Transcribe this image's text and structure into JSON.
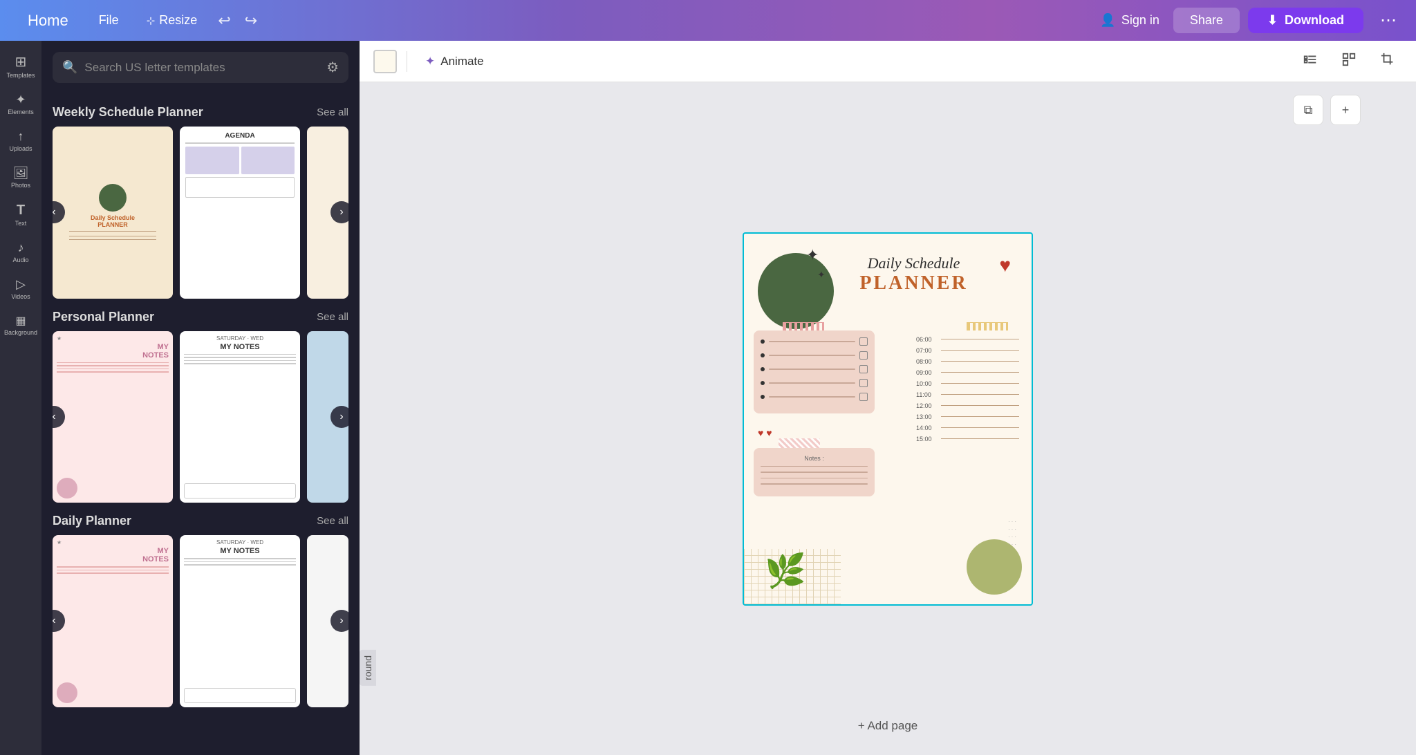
{
  "topNav": {
    "home": "Home",
    "file": "File",
    "resize": "Resize",
    "undo_icon": "↩",
    "redo_icon": "↪",
    "signin": "Sign in",
    "share": "Share",
    "download": "Download",
    "more_icon": "⋯"
  },
  "leftBar": {
    "items": [
      {
        "label": "Templates",
        "icon": "⊞"
      },
      {
        "label": "Elements",
        "icon": "✦"
      },
      {
        "label": "Uploads",
        "icon": "↑"
      },
      {
        "label": "Photos",
        "icon": "🖼"
      },
      {
        "label": "Text",
        "icon": "T"
      },
      {
        "label": "Audio",
        "icon": "♪"
      },
      {
        "label": "Videos",
        "icon": "▷"
      },
      {
        "label": "Background",
        "icon": "⬛"
      }
    ]
  },
  "search": {
    "placeholder": "Search US letter templates",
    "filter_icon": "⚙"
  },
  "sections": [
    {
      "title": "Weekly Schedule Planner",
      "see_all": "See all",
      "templates": [
        "weekly-1",
        "weekly-2",
        "weekly-3"
      ]
    },
    {
      "title": "Personal Planner",
      "see_all": "See all",
      "templates": [
        "personal-1",
        "personal-2",
        "personal-3"
      ]
    },
    {
      "title": "Daily Planner",
      "see_all": "See all",
      "templates": [
        "daily-1",
        "daily-2",
        "daily-3"
      ]
    }
  ],
  "canvasToolbar": {
    "animate": "Animate",
    "animate_icon": "✦",
    "duplicate_icon": "⧉",
    "add_icon": "+"
  },
  "planner": {
    "title_script": "Daily Schedule",
    "title_bold": "PLANNER",
    "times": [
      "06:00",
      "07:00",
      "08:00",
      "09:00",
      "10:00",
      "11:00",
      "12:00",
      "13:00",
      "14:00",
      "15:00"
    ],
    "notes_label": "Notes :",
    "todo_items": 5
  },
  "addPage": {
    "label": "+ Add page"
  },
  "roundLabel": "round"
}
